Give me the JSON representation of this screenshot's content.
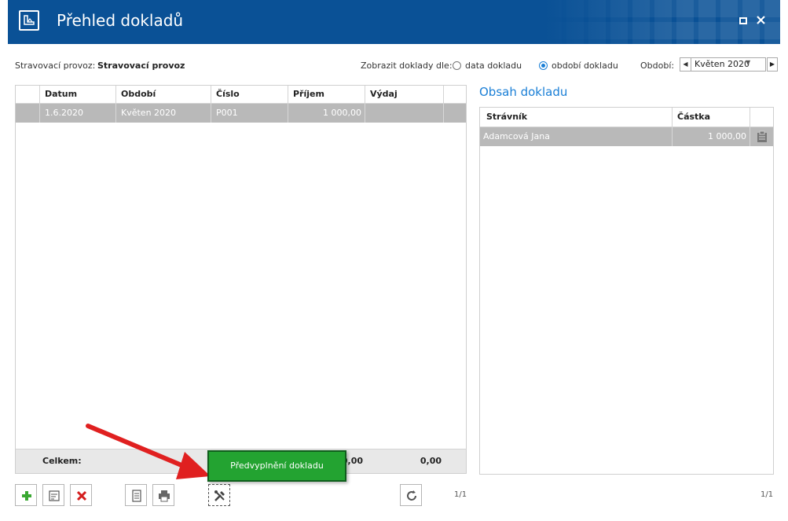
{
  "window": {
    "title": "Přehled dokladů"
  },
  "filters": {
    "provoz_label": "Stravovací provoz:",
    "provoz_value": "Stravovací provoz",
    "zobrazit_label": "Zobrazit doklady dle:",
    "option_data": "data dokladu",
    "option_obdobi": "období dokladu",
    "selected_option": "období dokladu",
    "obdobi_label": "Období:",
    "obdobi_value": "Květen 2020"
  },
  "documents": {
    "columns": [
      "Datum",
      "Období",
      "Číslo",
      "Příjem",
      "Výdaj"
    ],
    "rows": [
      {
        "datum": "1.6.2020",
        "obdobi": "Květen 2020",
        "cislo": "P001",
        "prijem": "1 000,00",
        "vydaj": ""
      }
    ],
    "footer_label": "Celkem:",
    "footer_prijem": "0,00",
    "footer_vydaj": "0,00"
  },
  "content": {
    "title": "Obsah dokladu",
    "columns": [
      "Strávník",
      "Částka"
    ],
    "rows": [
      {
        "stravnik": "Adamcová Jana",
        "castka": "1 000,00"
      }
    ]
  },
  "toolbar": {
    "pager_left": "1/1",
    "pager_right": "1/1"
  },
  "tooltip": {
    "text": "Předvyplnění dokladu"
  },
  "colors": {
    "title_bar": "#0a5196",
    "accent": "#1a7fd6",
    "selected_row": "#b9b9b9",
    "tooltip_bg": "#23a331",
    "annotation_arrow": "#e02020"
  }
}
